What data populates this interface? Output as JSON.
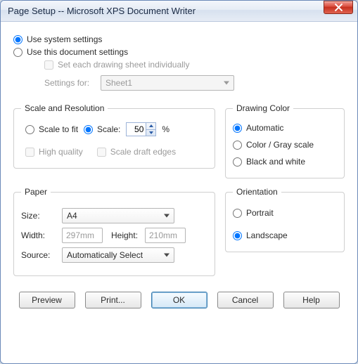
{
  "title": "Page Setup -- Microsoft XPS Document Writer",
  "top": {
    "use_system": "Use system settings",
    "use_document": "Use this document settings",
    "set_each": "Set each drawing sheet individually",
    "settings_for_label": "Settings for:",
    "settings_for_value": "Sheet1"
  },
  "scale": {
    "legend": "Scale and Resolution",
    "scale_to_fit": "Scale to fit",
    "scale_label": "Scale:",
    "scale_value": "50",
    "scale_suffix": "%",
    "high_quality": "High quality",
    "scale_draft": "Scale draft edges"
  },
  "drawing_color": {
    "legend": "Drawing Color",
    "automatic": "Automatic",
    "color_gray": "Color / Gray scale",
    "bw": "Black and white"
  },
  "paper": {
    "legend": "Paper",
    "size_label": "Size:",
    "size_value": "A4",
    "width_label": "Width:",
    "width_value": "297mm",
    "height_label": "Height:",
    "height_value": "210mm",
    "source_label": "Source:",
    "source_value": "Automatically Select"
  },
  "orientation": {
    "legend": "Orientation",
    "portrait": "Portrait",
    "landscape": "Landscape"
  },
  "buttons": {
    "preview": "Preview",
    "print": "Print...",
    "ok": "OK",
    "cancel": "Cancel",
    "help": "Help"
  }
}
